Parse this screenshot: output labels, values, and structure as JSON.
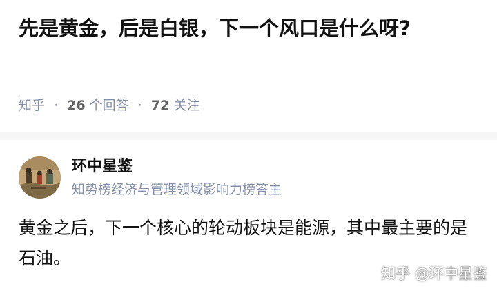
{
  "question": {
    "title": "先是黄金，后是白银，下一个风口是什么呀?",
    "source": "知乎",
    "answer_count": "26",
    "answer_label": "个回答",
    "follow_count": "72",
    "follow_label": "关注",
    "separator": "·"
  },
  "answer": {
    "author_name": "环中星鉴",
    "author_badge": "知势榜经济与管理领域影响力榜答主",
    "content": "黄金之后，下一个核心的轮动板块是能源，其中最主要的是石油。",
    "avatar_icon": "painting-avatar-icon"
  },
  "watermark": "知乎 @环中星鉴",
  "colors": {
    "title": "#121212",
    "meta": "#8590a6",
    "background": "#f6f6f6",
    "card": "#ffffff"
  }
}
